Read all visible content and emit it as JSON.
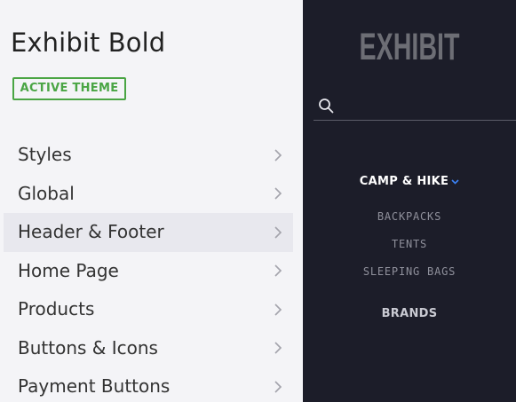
{
  "theme": {
    "name": "Exhibit Bold",
    "status_badge": "ACTIVE THEME",
    "badge_color": "#4aa544"
  },
  "menu": {
    "items": [
      {
        "label": "Styles",
        "icon": "chevron-right-icon",
        "highlighted": false
      },
      {
        "label": "Global",
        "icon": "chevron-right-icon",
        "highlighted": false
      },
      {
        "label": "Header & Footer",
        "icon": "chevron-right-icon",
        "highlighted": true
      },
      {
        "label": "Home Page",
        "icon": "chevron-right-icon",
        "highlighted": false
      },
      {
        "label": "Products",
        "icon": "chevron-right-icon",
        "highlighted": false
      },
      {
        "label": "Buttons & Icons",
        "icon": "chevron-right-icon",
        "highlighted": false
      },
      {
        "label": "Payment Buttons",
        "icon": "chevron-right-icon",
        "highlighted": false
      }
    ]
  },
  "preview": {
    "logo_text": "EXHIBIT",
    "background_color": "#1c1d29",
    "search_icon": "search-icon",
    "nav": {
      "main_label": "CAMP & HIKE",
      "caret_icon": "chevron-down-icon",
      "caret_color": "#3b82f6",
      "sub_items": [
        "BACKPACKS",
        "TENTS",
        "SLEEPING BAGS"
      ],
      "secondary_label": "BRANDS"
    }
  }
}
